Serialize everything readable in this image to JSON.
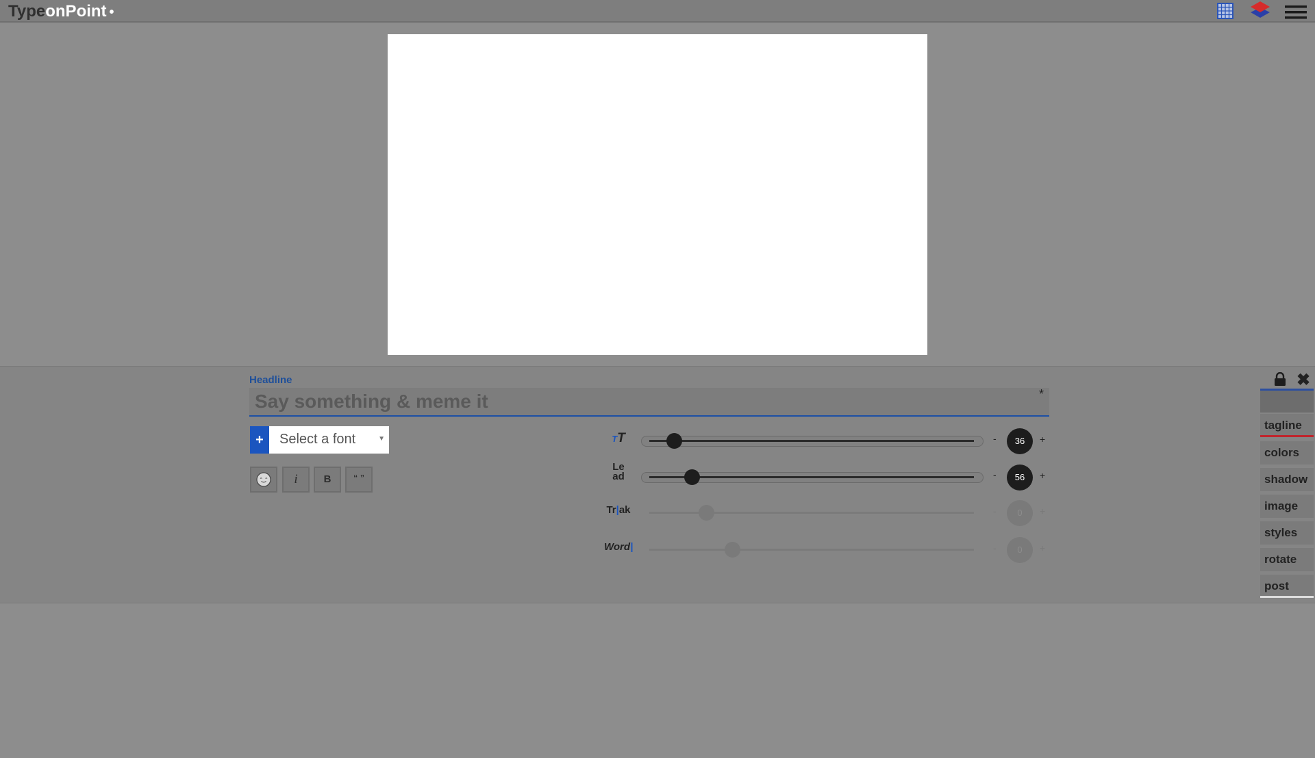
{
  "app": {
    "logo_part1": "Type",
    "logo_part2": "onPoint",
    "logo_dot": "•"
  },
  "header_icons": [
    "grid-icon",
    "layers-icon",
    "menu-icon"
  ],
  "editor": {
    "section_label": "Headline",
    "headline_placeholder": "Say something & meme it",
    "asterisk": "*",
    "font_add": "+",
    "font_select": "Select a font",
    "format_buttons": [
      "",
      "i",
      "B",
      "“ ”"
    ]
  },
  "sliders": [
    {
      "icon_text": "TT",
      "value": "36",
      "level": 0.1,
      "active": true
    },
    {
      "icon_text": "Le ad",
      "value": "56",
      "level": 0.15,
      "active": true
    },
    {
      "icon_text": "Trak",
      "value": "0",
      "level": 0.18,
      "active": false
    },
    {
      "icon_text": "Word",
      "value": "0",
      "level": 0.26,
      "active": false
    }
  ],
  "minus_label": "-",
  "plus_label": "+",
  "side_tabs": [
    "tagline",
    "colors",
    "shadow",
    "image",
    "styles",
    "rotate",
    "post"
  ],
  "colors": {
    "accent": "#1b55bf",
    "tagline_underline": "#c0242c"
  }
}
